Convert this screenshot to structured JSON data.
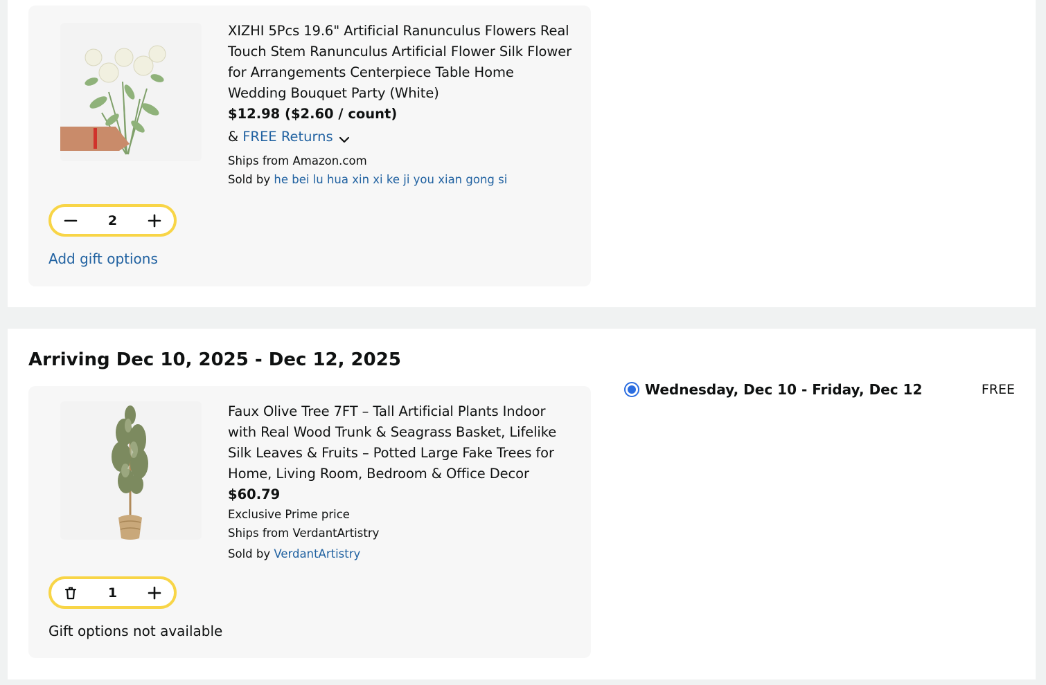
{
  "items": [
    {
      "title": "XIZHI 5Pcs 19.6\" Artificial Ranunculus Flowers Real Touch Stem Ranunculus Artificial Flower Silk Flower for Arrangements Centerpiece Table Home Wedding Bouquet Party (White)",
      "price": "$12.98 ($2.60 / count)",
      "returns_prefix": "&",
      "returns_label": "FREE Returns",
      "ships_from": "Ships from Amazon.com",
      "sold_by_prefix": "Sold by",
      "sold_by": "he bei lu hua xin xi ke ji you xian gong si",
      "quantity": "2",
      "gift_label": "Add gift options"
    },
    {
      "title": "Faux Olive Tree 7FT – Tall Artificial Plants Indoor with Real Wood Trunk & Seagrass Basket, Lifelike Silk Leaves & Fruits – Potted Large Fake Trees for Home, Living Room, Bedroom & Office Decor",
      "price": "$60.79",
      "exclusive": "Exclusive Prime price",
      "ships_from": "Ships from VerdantArtistry",
      "sold_by_prefix": "Sold by",
      "sold_by": "VerdantArtistry",
      "quantity": "1",
      "gift_label": "Gift options not available"
    }
  ],
  "delivery": {
    "arriving": "Arriving Dec 10, 2025 - Dec 12, 2025",
    "option_label": "Wednesday, Dec 10 - Friday, Dec 12",
    "option_cost": "FREE"
  },
  "icons": {
    "decrement": "minus-icon",
    "increment": "plus-icon",
    "delete": "trash-icon",
    "chevron": "chevron-down-icon"
  },
  "colors": {
    "link": "#2162a1",
    "qty_border": "#f8d547",
    "radio": "#2b6de0",
    "card_bg": "#f7f7f7"
  }
}
